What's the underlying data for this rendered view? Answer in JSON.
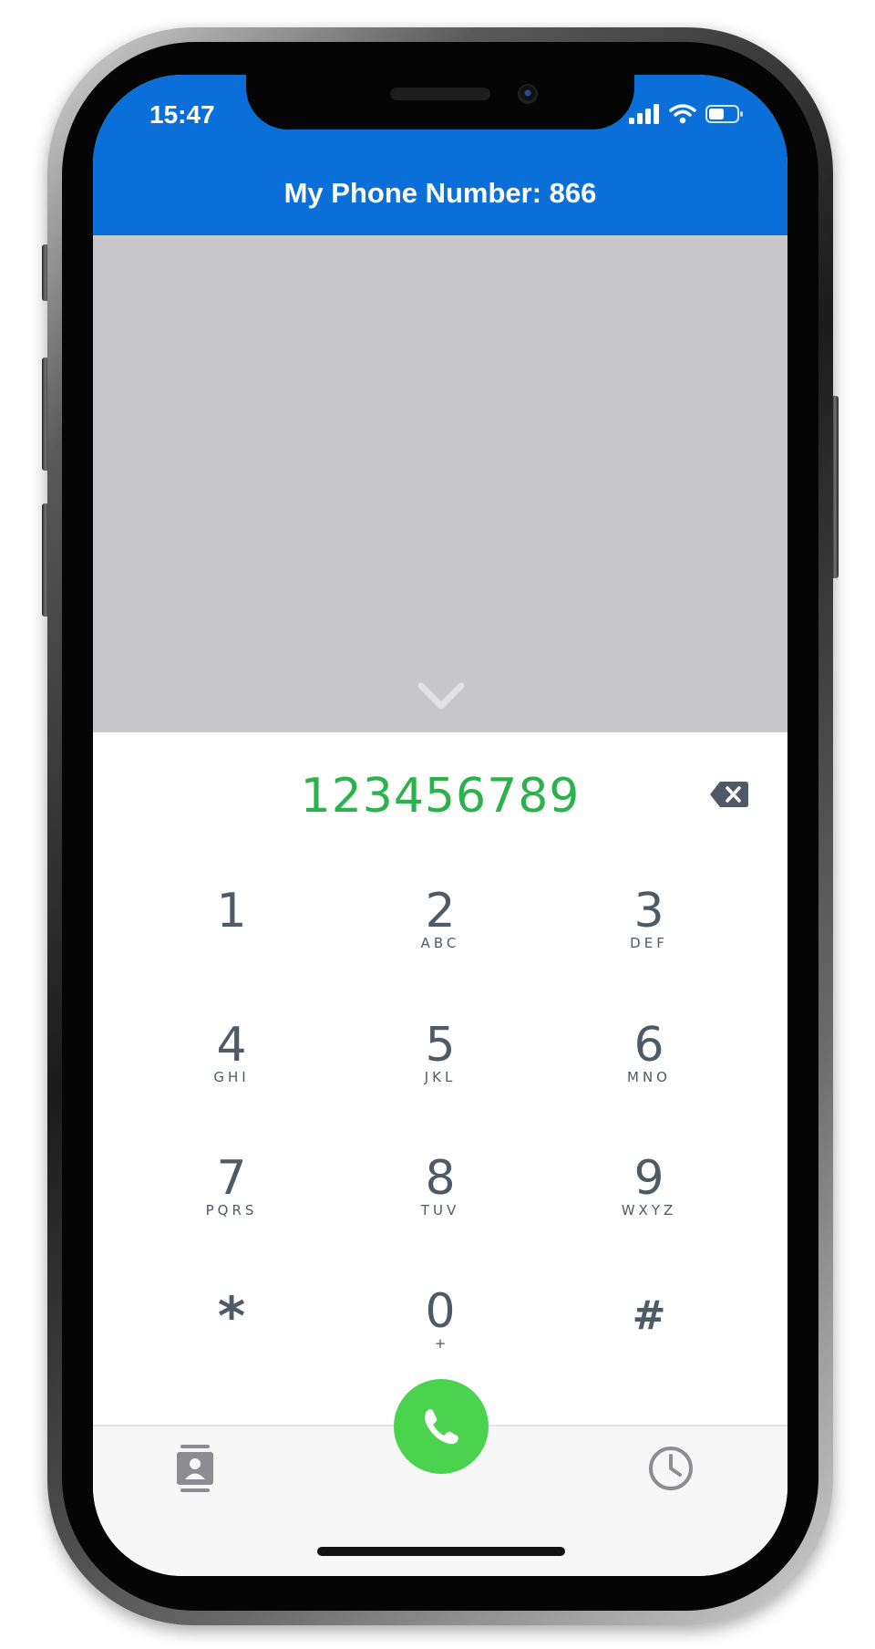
{
  "status_bar": {
    "time": "15:47",
    "signal_icon": "cellular-signal-icon",
    "wifi_icon": "wifi-icon",
    "battery_icon": "battery-icon"
  },
  "header": {
    "title": "My Phone Number: 866"
  },
  "video_area": {
    "collapse_icon": "chevron-down-icon"
  },
  "dialer": {
    "dialed_number": "123456789",
    "backspace_icon": "backspace-icon",
    "keys": [
      {
        "digit": "1",
        "letters": ""
      },
      {
        "digit": "2",
        "letters": "ABC"
      },
      {
        "digit": "3",
        "letters": "DEF"
      },
      {
        "digit": "4",
        "letters": "GHI"
      },
      {
        "digit": "5",
        "letters": "JKL"
      },
      {
        "digit": "6",
        "letters": "MNO"
      },
      {
        "digit": "7",
        "letters": "PQRS"
      },
      {
        "digit": "8",
        "letters": "TUV"
      },
      {
        "digit": "9",
        "letters": "WXYZ"
      },
      {
        "digit": "*",
        "letters": ""
      },
      {
        "digit": "0",
        "letters": "+"
      },
      {
        "digit": "#",
        "letters": ""
      }
    ]
  },
  "bottom_bar": {
    "contacts_icon": "contacts-icon",
    "call_icon": "phone-icon",
    "recents_icon": "clock-icon"
  },
  "colors": {
    "header_blue": "#0a6fd9",
    "dialed_green": "#2bb24c",
    "call_green": "#4bd34f",
    "key_gray": "#4e5a66",
    "video_gray": "#c7c7c9"
  }
}
